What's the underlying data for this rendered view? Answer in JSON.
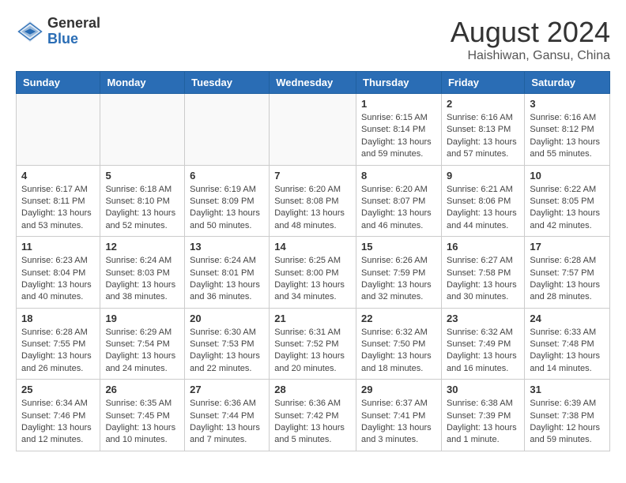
{
  "header": {
    "logo_general": "General",
    "logo_blue": "Blue",
    "month_title": "August 2024",
    "subtitle": "Haishiwan, Gansu, China"
  },
  "weekdays": [
    "Sunday",
    "Monday",
    "Tuesday",
    "Wednesday",
    "Thursday",
    "Friday",
    "Saturday"
  ],
  "weeks": [
    [
      {
        "day": "",
        "info": ""
      },
      {
        "day": "",
        "info": ""
      },
      {
        "day": "",
        "info": ""
      },
      {
        "day": "",
        "info": ""
      },
      {
        "day": "1",
        "info": "Sunrise: 6:15 AM\nSunset: 8:14 PM\nDaylight: 13 hours\nand 59 minutes."
      },
      {
        "day": "2",
        "info": "Sunrise: 6:16 AM\nSunset: 8:13 PM\nDaylight: 13 hours\nand 57 minutes."
      },
      {
        "day": "3",
        "info": "Sunrise: 6:16 AM\nSunset: 8:12 PM\nDaylight: 13 hours\nand 55 minutes."
      }
    ],
    [
      {
        "day": "4",
        "info": "Sunrise: 6:17 AM\nSunset: 8:11 PM\nDaylight: 13 hours\nand 53 minutes."
      },
      {
        "day": "5",
        "info": "Sunrise: 6:18 AM\nSunset: 8:10 PM\nDaylight: 13 hours\nand 52 minutes."
      },
      {
        "day": "6",
        "info": "Sunrise: 6:19 AM\nSunset: 8:09 PM\nDaylight: 13 hours\nand 50 minutes."
      },
      {
        "day": "7",
        "info": "Sunrise: 6:20 AM\nSunset: 8:08 PM\nDaylight: 13 hours\nand 48 minutes."
      },
      {
        "day": "8",
        "info": "Sunrise: 6:20 AM\nSunset: 8:07 PM\nDaylight: 13 hours\nand 46 minutes."
      },
      {
        "day": "9",
        "info": "Sunrise: 6:21 AM\nSunset: 8:06 PM\nDaylight: 13 hours\nand 44 minutes."
      },
      {
        "day": "10",
        "info": "Sunrise: 6:22 AM\nSunset: 8:05 PM\nDaylight: 13 hours\nand 42 minutes."
      }
    ],
    [
      {
        "day": "11",
        "info": "Sunrise: 6:23 AM\nSunset: 8:04 PM\nDaylight: 13 hours\nand 40 minutes."
      },
      {
        "day": "12",
        "info": "Sunrise: 6:24 AM\nSunset: 8:03 PM\nDaylight: 13 hours\nand 38 minutes."
      },
      {
        "day": "13",
        "info": "Sunrise: 6:24 AM\nSunset: 8:01 PM\nDaylight: 13 hours\nand 36 minutes."
      },
      {
        "day": "14",
        "info": "Sunrise: 6:25 AM\nSunset: 8:00 PM\nDaylight: 13 hours\nand 34 minutes."
      },
      {
        "day": "15",
        "info": "Sunrise: 6:26 AM\nSunset: 7:59 PM\nDaylight: 13 hours\nand 32 minutes."
      },
      {
        "day": "16",
        "info": "Sunrise: 6:27 AM\nSunset: 7:58 PM\nDaylight: 13 hours\nand 30 minutes."
      },
      {
        "day": "17",
        "info": "Sunrise: 6:28 AM\nSunset: 7:57 PM\nDaylight: 13 hours\nand 28 minutes."
      }
    ],
    [
      {
        "day": "18",
        "info": "Sunrise: 6:28 AM\nSunset: 7:55 PM\nDaylight: 13 hours\nand 26 minutes."
      },
      {
        "day": "19",
        "info": "Sunrise: 6:29 AM\nSunset: 7:54 PM\nDaylight: 13 hours\nand 24 minutes."
      },
      {
        "day": "20",
        "info": "Sunrise: 6:30 AM\nSunset: 7:53 PM\nDaylight: 13 hours\nand 22 minutes."
      },
      {
        "day": "21",
        "info": "Sunrise: 6:31 AM\nSunset: 7:52 PM\nDaylight: 13 hours\nand 20 minutes."
      },
      {
        "day": "22",
        "info": "Sunrise: 6:32 AM\nSunset: 7:50 PM\nDaylight: 13 hours\nand 18 minutes."
      },
      {
        "day": "23",
        "info": "Sunrise: 6:32 AM\nSunset: 7:49 PM\nDaylight: 13 hours\nand 16 minutes."
      },
      {
        "day": "24",
        "info": "Sunrise: 6:33 AM\nSunset: 7:48 PM\nDaylight: 13 hours\nand 14 minutes."
      }
    ],
    [
      {
        "day": "25",
        "info": "Sunrise: 6:34 AM\nSunset: 7:46 PM\nDaylight: 13 hours\nand 12 minutes."
      },
      {
        "day": "26",
        "info": "Sunrise: 6:35 AM\nSunset: 7:45 PM\nDaylight: 13 hours\nand 10 minutes."
      },
      {
        "day": "27",
        "info": "Sunrise: 6:36 AM\nSunset: 7:44 PM\nDaylight: 13 hours\nand 7 minutes."
      },
      {
        "day": "28",
        "info": "Sunrise: 6:36 AM\nSunset: 7:42 PM\nDaylight: 13 hours\nand 5 minutes."
      },
      {
        "day": "29",
        "info": "Sunrise: 6:37 AM\nSunset: 7:41 PM\nDaylight: 13 hours\nand 3 minutes."
      },
      {
        "day": "30",
        "info": "Sunrise: 6:38 AM\nSunset: 7:39 PM\nDaylight: 13 hours\nand 1 minute."
      },
      {
        "day": "31",
        "info": "Sunrise: 6:39 AM\nSunset: 7:38 PM\nDaylight: 12 hours\nand 59 minutes."
      }
    ]
  ]
}
